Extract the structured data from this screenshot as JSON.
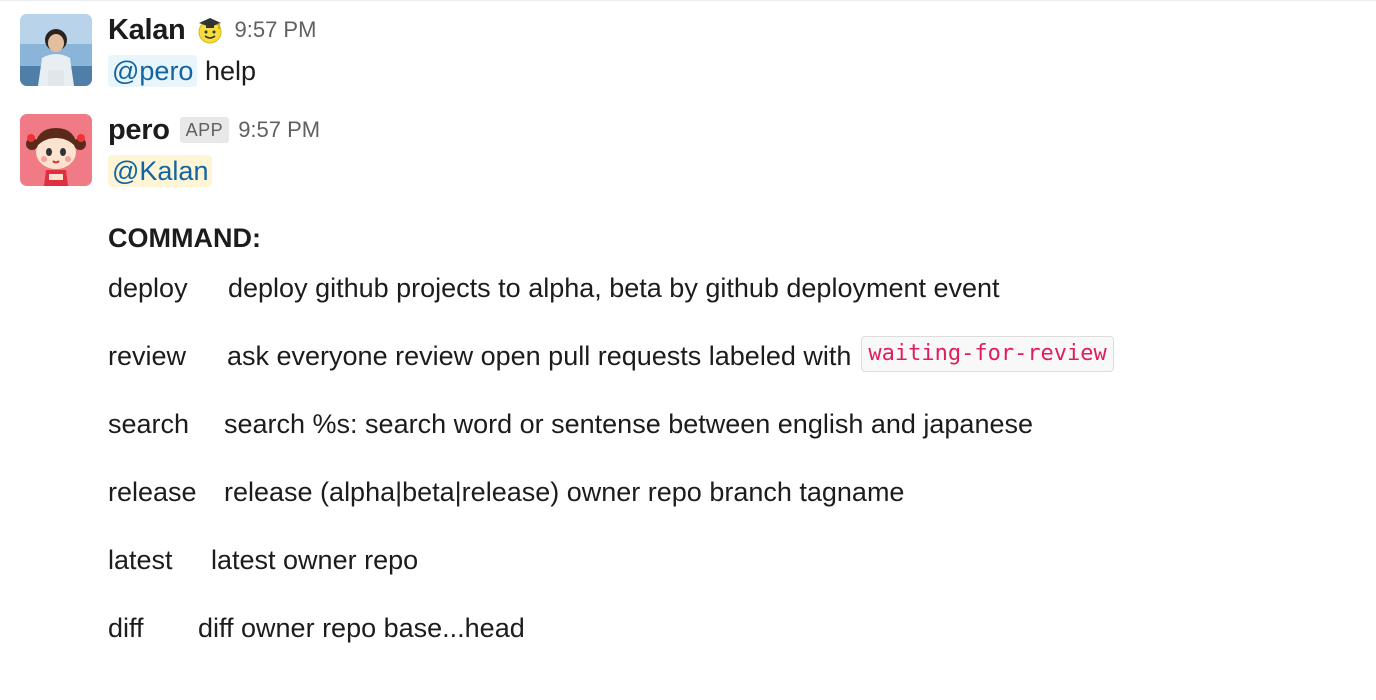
{
  "messages": {
    "kalan": {
      "sender": "Kalan",
      "status_emoji": "graduate-face-emoji",
      "timestamp": "9:57 PM",
      "mention": "@pero",
      "text": "help"
    },
    "pero": {
      "sender": "pero",
      "badge": "APP",
      "timestamp": "9:57 PM",
      "mention": "@Kalan",
      "heading": "COMMAND:",
      "commands": [
        {
          "name": "deploy",
          "description": "deploy github projects to alpha, beta by github deployment event"
        },
        {
          "name": "review",
          "description": "ask everyone review open pull requests labeled with",
          "code": "waiting-for-review"
        },
        {
          "name": "search",
          "description": "search %s: search word or sentense between english and japanese"
        },
        {
          "name": "release",
          "description": "release (alpha|beta|release) owner repo branch tagname"
        },
        {
          "name": "latest",
          "description": "latest owner repo"
        },
        {
          "name": "diff",
          "description": "diff owner repo base...head"
        }
      ]
    }
  },
  "colors": {
    "mention": "#1264a3",
    "mention_bg": "#e8f5fa",
    "mention_self_bg": "#fef5d6",
    "code": "#e01e5a",
    "timestamp": "#616061"
  }
}
